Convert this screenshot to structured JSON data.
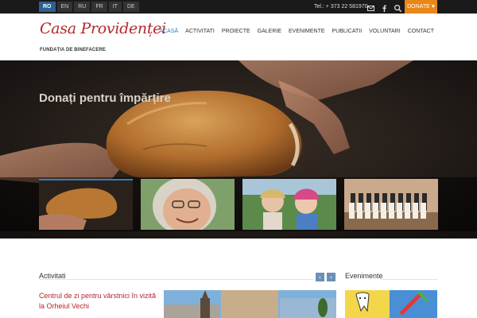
{
  "topbar": {
    "languages": [
      "RO",
      "EN",
      "RU",
      "FR",
      "IT",
      "DE"
    ],
    "phone": "Tel.: + 373 22 581970",
    "donate_label": "DONATE",
    "icons": [
      "mail-icon",
      "facebook-icon",
      "search-icon",
      "heart-icon"
    ]
  },
  "header": {
    "logo_text": "Casa Providenței",
    "logo_subtitle": "FUNDAȚIA DE BINEFACERE",
    "nav": [
      "ACASĂ",
      "ACTIVITATI",
      "PROIECTE",
      "GALERIE",
      "EVENIMENTE",
      "PUBLICATII",
      "VOLUNTARI",
      "CONTACT"
    ]
  },
  "hero": {
    "title": "Donați pentru împărțire"
  },
  "sections": {
    "activities_title": "Activitati",
    "activity_link": "Centrul de zi pentru vârstnici în vizită la Orheiul Vechi",
    "events_title": "Evenimente"
  },
  "colors": {
    "accent_red": "#b3272c",
    "accent_blue": "#2f7fc0",
    "donate_orange": "#e8861a",
    "topbar": "#1a1a1a"
  }
}
